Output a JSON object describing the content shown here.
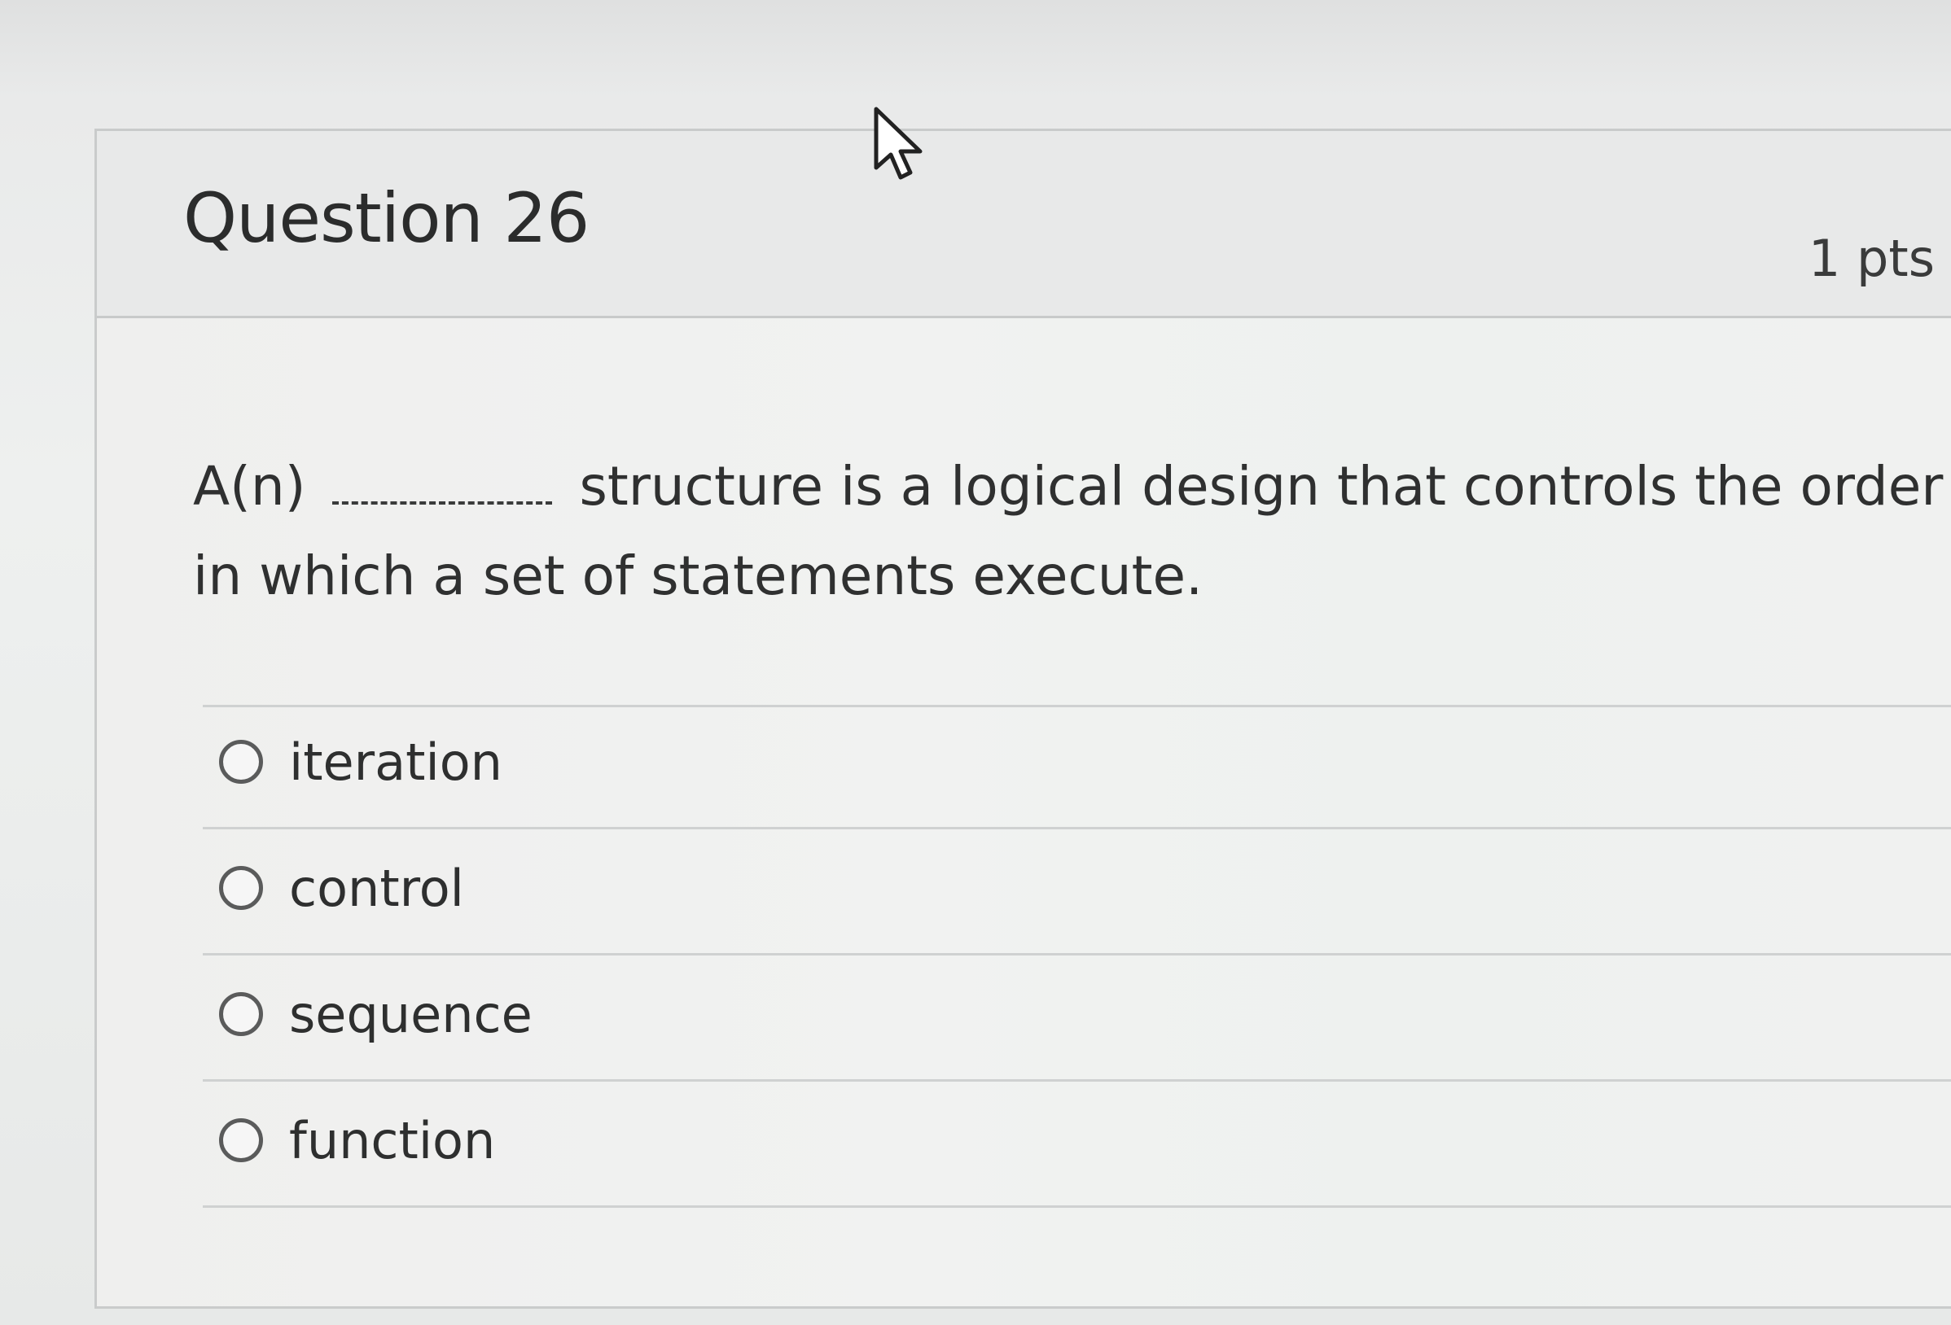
{
  "question": {
    "title": "Question 26",
    "points": "1 pts",
    "text_before": "A(n)",
    "text_after": "structure is a logical design that controls the order in which a set of statements execute."
  },
  "answers": [
    {
      "label": "iteration"
    },
    {
      "label": "control"
    },
    {
      "label": "sequence"
    },
    {
      "label": "function"
    }
  ],
  "colors": {
    "card_background": "#f0f1f0",
    "header_background": "#e8e9e9",
    "text": "#2e2f2f",
    "border": "#c9cbcb"
  },
  "icons": {
    "cursor": "pointer-cursor-icon",
    "radio": "radio-button-icon"
  }
}
